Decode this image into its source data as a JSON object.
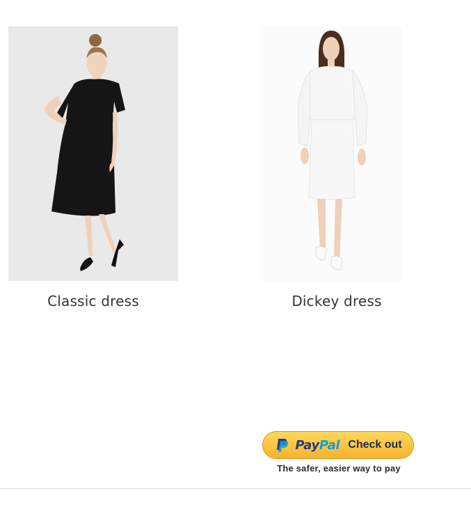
{
  "products": [
    {
      "name": "Classic dress",
      "image": "woman in black short-sleeve knee-length dress with black heels"
    },
    {
      "name": "Dickey dress",
      "image": "woman in white long-sleeve pleated dress with white flats"
    }
  ],
  "paypal": {
    "brand_pay": "Pay",
    "brand_pal": "Pal",
    "checkout_label": "Check out",
    "tagline": "The safer, easier way to pay"
  },
  "colors": {
    "paypal_gold": "#f6b32f",
    "paypal_dark_blue": "#253b80",
    "paypal_light_blue": "#179bd7",
    "product_text": "#333333"
  }
}
